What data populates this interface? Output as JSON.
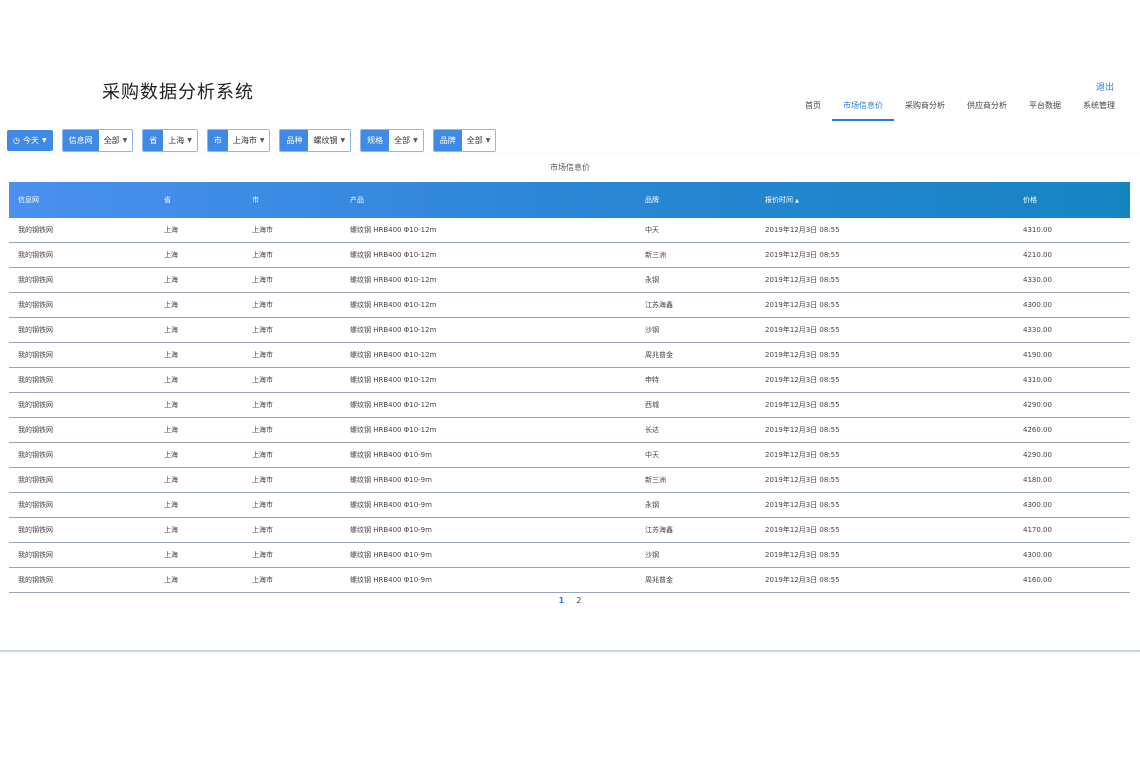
{
  "header": {
    "title": "采购数据分析系统",
    "logout": "退出",
    "nav": [
      "首页",
      "市场信息价",
      "采购商分析",
      "供应商分析",
      "平台数据",
      "系统管理"
    ],
    "active_nav": 1
  },
  "filters": {
    "date": "今天",
    "items": [
      {
        "label": "信息网",
        "value": "全部"
      },
      {
        "label": "省",
        "value": "上海"
      },
      {
        "label": "市",
        "value": "上海市"
      },
      {
        "label": "品种",
        "value": "螺纹钢"
      },
      {
        "label": "规格",
        "value": "全部"
      },
      {
        "label": "品牌",
        "value": "全部"
      }
    ]
  },
  "table": {
    "title": "市场信息价",
    "columns": [
      "信息网",
      "省",
      "市",
      "产品",
      "品牌",
      "报价时间",
      "价格"
    ],
    "rows": [
      [
        "我的钢铁网",
        "上海",
        "上海市",
        "螺纹钢 HRB400 Φ10-12m",
        "中天",
        "2019年12月3日 08:55",
        "4310.00"
      ],
      [
        "我的钢铁网",
        "上海",
        "上海市",
        "螺纹钢 HRB400 Φ10-12m",
        "新三洲",
        "2019年12月3日 08:55",
        "4210.00"
      ],
      [
        "我的钢铁网",
        "上海",
        "上海市",
        "螺纹钢 HRB400 Φ10-12m",
        "永钢",
        "2019年12月3日 08:55",
        "4330.00"
      ],
      [
        "我的钢铁网",
        "上海",
        "上海市",
        "螺纹钢 HRB400 Φ10-12m",
        "江苏海鑫",
        "2019年12月3日 08:55",
        "4300.00"
      ],
      [
        "我的钢铁网",
        "上海",
        "上海市",
        "螺纹钢 HRB400 Φ10-12m",
        "沙钢",
        "2019年12月3日 08:55",
        "4330.00"
      ],
      [
        "我的钢铁网",
        "上海",
        "上海市",
        "螺纹钢 HRB400 Φ10-12m",
        "周兆普金",
        "2019年12月3日 08:55",
        "4190.00"
      ],
      [
        "我的钢铁网",
        "上海",
        "上海市",
        "螺纹钢 HRB400 Φ10-12m",
        "申特",
        "2019年12月3日 08:55",
        "4310.00"
      ],
      [
        "我的钢铁网",
        "上海",
        "上海市",
        "螺纹钢 HRB400 Φ10-12m",
        "西城",
        "2019年12月3日 08:55",
        "4290.00"
      ],
      [
        "我的钢铁网",
        "上海",
        "上海市",
        "螺纹钢 HRB400 Φ10-12m",
        "长达",
        "2019年12月3日 08:55",
        "4260.00"
      ],
      [
        "我的钢铁网",
        "上海",
        "上海市",
        "螺纹钢 HRB400 Φ10-9m",
        "中天",
        "2019年12月3日 08:55",
        "4290.00"
      ],
      [
        "我的钢铁网",
        "上海",
        "上海市",
        "螺纹钢 HRB400 Φ10-9m",
        "新三洲",
        "2019年12月3日 08:55",
        "4180.00"
      ],
      [
        "我的钢铁网",
        "上海",
        "上海市",
        "螺纹钢 HRB400 Φ10-9m",
        "永钢",
        "2019年12月3日 08:55",
        "4300.00"
      ],
      [
        "我的钢铁网",
        "上海",
        "上海市",
        "螺纹钢 HRB400 Φ10-9m",
        "江苏海鑫",
        "2019年12月3日 08:55",
        "4170.00"
      ],
      [
        "我的钢铁网",
        "上海",
        "上海市",
        "螺纹钢 HRB400 Φ10-9m",
        "沙钢",
        "2019年12月3日 08:55",
        "4300.00"
      ],
      [
        "我的钢铁网",
        "上海",
        "上海市",
        "螺纹钢 HRB400 Φ10-9m",
        "周兆普金",
        "2019年12月3日 08:55",
        "4160.00"
      ]
    ]
  },
  "pagination": {
    "pages": [
      "1",
      "2"
    ],
    "active": 0
  },
  "colors": {
    "accent": "#3f8ae6",
    "header_start": "#4a90f0",
    "header_end": "#1585c2"
  }
}
